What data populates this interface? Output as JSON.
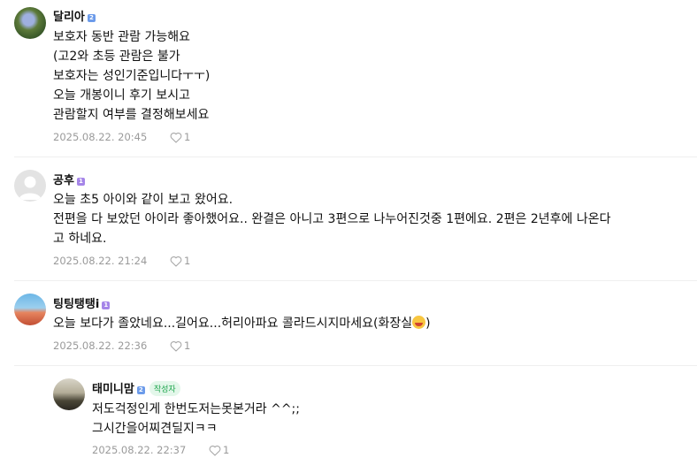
{
  "comments": [
    {
      "nickname": "달리아",
      "level": "2",
      "lines": [
        "보호자 동반 관람 가능해요",
        "(고2와 초등 관람은 불가",
        "보호자는 성인기준입니다ㅜㅜ)",
        "오늘 개봉이니 후기 보시고",
        "관람할지 여부를 결정해보세요"
      ],
      "date": "2025.08.22. 20:45",
      "likes": "1"
    },
    {
      "nickname": "공후",
      "level": "1",
      "lines": [
        "오늘 초5 아이와 같이 보고 왔어요.",
        "전편을 다 보았던 아이라 좋아했어요.. 완결은 아니고 3편으로 나누어진것중 1편에요. 2편은 2년후에 나온다",
        "고 하네요."
      ],
      "date": "2025.08.22. 21:24",
      "likes": "1"
    },
    {
      "nickname": "팅팅탱탱i",
      "level": "1",
      "line": "오늘 보다가 졸았네요...길어요...허리아파요 콜라드시지마세요(화장실",
      "line_end": ")",
      "date": "2025.08.22. 22:36",
      "likes": "1"
    }
  ],
  "reply": {
    "nickname": "태미니맘",
    "level": "2",
    "author_badge": "작성자",
    "lines": [
      "저도걱정인게 한번도저는못본거라 ^^;;",
      "그시간을어찌견딜지ㅋㅋ"
    ],
    "date": "2025.08.22. 22:37",
    "likes": "1"
  },
  "icons": {
    "like": "heart-outline-icon",
    "emoji": "laughing-emoji-icon"
  },
  "colors": {
    "level_blue": "#6c9bea",
    "level_purple": "#a585e8",
    "author_badge": "#1aa34a",
    "meta": "#9a9a9a"
  }
}
